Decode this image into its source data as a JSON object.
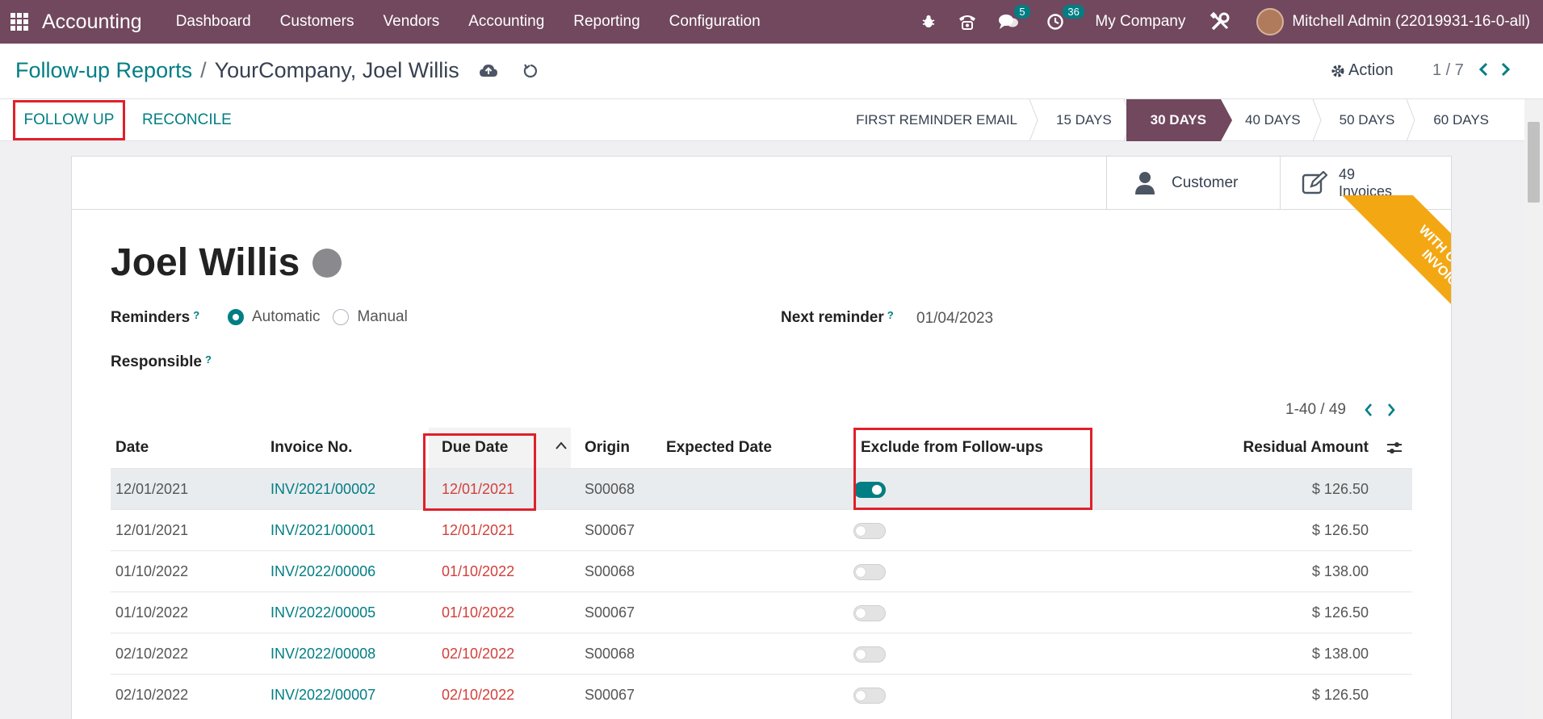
{
  "navbar": {
    "app_name": "Accounting",
    "menu": [
      "Dashboard",
      "Customers",
      "Vendors",
      "Accounting",
      "Reporting",
      "Configuration"
    ],
    "messages_count": "5",
    "activities_count": "36",
    "company": "My Company",
    "user": "Mitchell Admin (22019931-16-0-all)"
  },
  "breadcrumb": {
    "parent": "Follow-up Reports",
    "separator": "/",
    "current": "YourCompany, Joel Willis"
  },
  "control": {
    "action_label": "Action",
    "pager": "1 / 7"
  },
  "statusbar": {
    "follow_up_label": "FOLLOW UP",
    "reconcile_label": "RECONCILE",
    "stages": [
      "FIRST REMINDER EMAIL",
      "15 DAYS",
      "30 DAYS",
      "40 DAYS",
      "50 DAYS",
      "60 DAYS"
    ],
    "active_stage": "30 DAYS"
  },
  "smart_buttons": {
    "customer_label": "Customer",
    "invoices_count": "49",
    "invoices_label": "Invoices"
  },
  "ribbon": {
    "line1": "WITH OVERDUE",
    "line2": "INVOICES"
  },
  "partner": {
    "name": "Joel Willis",
    "reminders_label": "Reminders",
    "reminder_options": [
      "Automatic",
      "Manual"
    ],
    "reminder_selected": "Automatic",
    "responsible_label": "Responsible",
    "next_reminder_label": "Next reminder",
    "next_reminder_value": "01/04/2023",
    "help_mark": "?"
  },
  "list": {
    "pager": "1-40 / 49",
    "columns": {
      "date": "Date",
      "invoice": "Invoice No.",
      "due": "Due Date",
      "origin": "Origin",
      "expected": "Expected Date",
      "exclude": "Exclude from Follow-ups",
      "residual": "Residual Amount"
    },
    "rows": [
      {
        "date": "12/01/2021",
        "invoice": "INV/2021/00002",
        "due": "12/01/2021",
        "origin": "S00068",
        "expected": "",
        "excluded": true,
        "amount": "$ 126.50"
      },
      {
        "date": "12/01/2021",
        "invoice": "INV/2021/00001",
        "due": "12/01/2021",
        "origin": "S00067",
        "expected": "",
        "excluded": false,
        "amount": "$ 126.50"
      },
      {
        "date": "01/10/2022",
        "invoice": "INV/2022/00006",
        "due": "01/10/2022",
        "origin": "S00068",
        "expected": "",
        "excluded": false,
        "amount": "$ 138.00"
      },
      {
        "date": "01/10/2022",
        "invoice": "INV/2022/00005",
        "due": "01/10/2022",
        "origin": "S00067",
        "expected": "",
        "excluded": false,
        "amount": "$ 126.50"
      },
      {
        "date": "02/10/2022",
        "invoice": "INV/2022/00008",
        "due": "02/10/2022",
        "origin": "S00068",
        "expected": "",
        "excluded": false,
        "amount": "$ 138.00"
      },
      {
        "date": "02/10/2022",
        "invoice": "INV/2022/00007",
        "due": "02/10/2022",
        "origin": "S00067",
        "expected": "",
        "excluded": false,
        "amount": "$ 126.50"
      }
    ]
  },
  "colors": {
    "brand": "#71485e",
    "accent": "#017e84",
    "overdue": "#d23f3a",
    "ribbon": "#f3a712",
    "annotation": "#e0202a"
  }
}
